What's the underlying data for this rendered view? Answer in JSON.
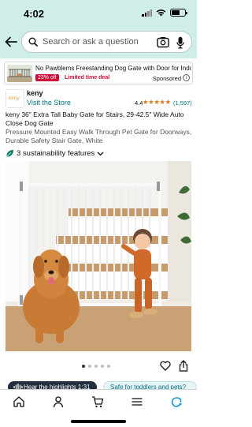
{
  "status_bar": {
    "time": "4:02"
  },
  "search": {
    "placeholder": "Search or ask a question"
  },
  "sponsored_ad": {
    "title": "No Pawblems Freestanding Dog Gate with Door for Indoor ...",
    "discount": "23% off",
    "deal_label": "Limited time deal",
    "sponsored_label": "Sponsored",
    "info_symbol": "i"
  },
  "brand": {
    "logo_text": "keny",
    "name": "keny",
    "store_link": "Visit the Store",
    "rating": "4.4",
    "stars": "★★★★★",
    "review_count": "(1,597)"
  },
  "product": {
    "title": "keny 36\" Extra Tall Baby Gate for Stairs, 29-42.5\" Wide Auto Close Dog Gate",
    "subtitle": "Pressure Mounted Easy Walk Through Pet Gate for Doorways, Durable Safety Stair Gate, White",
    "sustainability": "3 sustainability features",
    "image_count": 5,
    "active_image": 1
  },
  "chips": {
    "audio": "Hear the highlights 1:31",
    "question": "Safe for toddlers and pets?"
  },
  "tabs": [
    "home-icon",
    "account-icon",
    "cart-icon",
    "menu-icon",
    "rufus-icon"
  ],
  "colors": {
    "header": "#cfeee9",
    "link": "#007185",
    "deal": "#cc0c39",
    "star": "#de7921"
  }
}
